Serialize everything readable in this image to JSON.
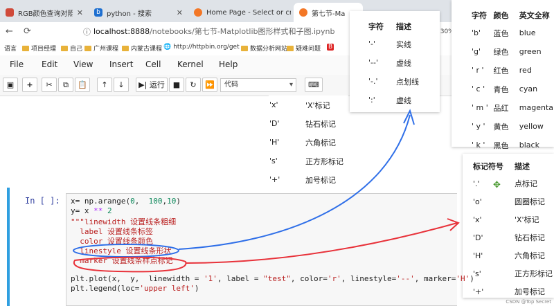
{
  "tabs": [
    {
      "label": "RGB颜色查询对照表_颜色代码",
      "icon": "page-icon",
      "active": false
    },
    {
      "label": "python - 搜索",
      "icon": "bing-icon",
      "active": false
    },
    {
      "label": "Home Page - Select or create",
      "icon": "jupyter-icon",
      "active": false
    },
    {
      "label": "第七节-Ma",
      "icon": "jupyter-icon",
      "active": true
    }
  ],
  "address": {
    "host": "localhost:8888",
    "path": "/notebooks/第七节-Matplotlib图形样式和子图.ipynb",
    "zoom": "130%"
  },
  "bookmarks": [
    "语言",
    "项目经理",
    "自己",
    "广州课程",
    "内蒙古课程",
    "http://httpbin.org/get",
    "数据分析网站",
    "疑难问题",
    "B"
  ],
  "menu": [
    "File",
    "Edit",
    "View",
    "Insert",
    "Cell",
    "Kernel",
    "Help"
  ],
  "toolbar": {
    "run_label": "运行",
    "cell_type": "代码"
  },
  "linestyle_table": {
    "headers": [
      "字符",
      "描述"
    ],
    "rows": [
      [
        "'-'",
        "实线"
      ],
      [
        "'--'",
        "虚线"
      ],
      [
        "'-.'",
        "点划线"
      ],
      [
        "':'",
        "虚线"
      ]
    ]
  },
  "color_table": {
    "headers": [
      "字符",
      "颜色",
      "英文全称"
    ],
    "rows": [
      [
        "'b'",
        "蓝色",
        "blue"
      ],
      [
        "'g'",
        "绿色",
        "green"
      ],
      [
        "' r '",
        "红色",
        "red"
      ],
      [
        "' c '",
        "青色",
        "cyan"
      ],
      [
        "' m '",
        "品红",
        "magenta"
      ],
      [
        "' y '",
        "黄色",
        "yellow"
      ],
      [
        "' k '",
        "黑色",
        "black"
      ]
    ]
  },
  "marker_table_bg": {
    "rows": [
      [
        "'x'",
        "'X'标记"
      ],
      [
        "'D'",
        "钻石标记"
      ],
      [
        "'H'",
        "六角标记"
      ],
      [
        "'s'",
        "正方形标记"
      ],
      [
        "'+'",
        "加号标记"
      ]
    ]
  },
  "marker_table": {
    "headers": [
      "标记符号",
      "描述"
    ],
    "rows": [
      [
        "'.'",
        "点标记"
      ],
      [
        "'o'",
        "圆圈标记"
      ],
      [
        "'x'",
        "'X'标记"
      ],
      [
        "'D'",
        "钻石标记"
      ],
      [
        "'H'",
        "六角标记"
      ],
      [
        "'s'",
        "正方形标记"
      ],
      [
        "'+'",
        "加号标记"
      ]
    ]
  },
  "cell": {
    "prompt": "In [ ]:",
    "lines": [
      "x= np.arange(0, 100,10)",
      "y= x ** 2",
      "\"\"\"linewidth 设置线条粗细",
      "  label 设置线条标签",
      "  color 设置线条颜色",
      "  linestyle 设置线条形状",
      "  marker 设置线条样点标记",
      "",
      "plt.plot(x, y, linewidth = '1', label = \"test\", color='r', linestyle='--', marker='H')",
      "plt.legend(loc='upper left')"
    ]
  },
  "watermark": "CSDN @Top Secret",
  "annotation_colors": {
    "blue": "#2f6fe8",
    "red": "#e8323a"
  }
}
